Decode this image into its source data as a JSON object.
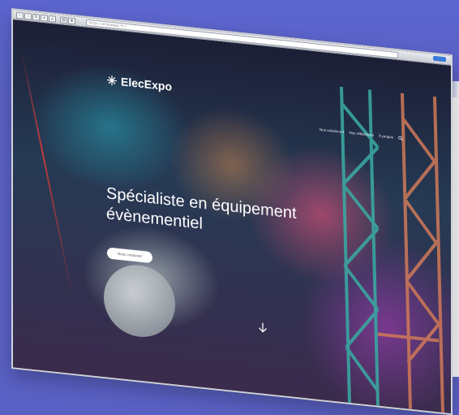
{
  "browser": {
    "url": "http://elecexpo.fr/",
    "toolbar_icons": [
      "back-icon",
      "forward-icon",
      "reload-icon",
      "stop-icon",
      "home-icon",
      "print-icon",
      "bookmark-icon"
    ]
  },
  "site": {
    "logo_text": "ElecExpo",
    "logo_icon": "spark-plug-icon"
  },
  "nav": {
    "items": [
      "Nos solutions ▾",
      "Nos références",
      "À propos"
    ],
    "search_icon": "search-icon"
  },
  "hero": {
    "title_line1": "Spécialiste en équipement",
    "title_line2": "évènementiel",
    "cta_label": "Nous contacter",
    "scroll_icon": "arrow-down-icon"
  },
  "colors": {
    "background": "#5a61c4",
    "cta_bg": "#ffffff",
    "text": "#ffffff"
  }
}
